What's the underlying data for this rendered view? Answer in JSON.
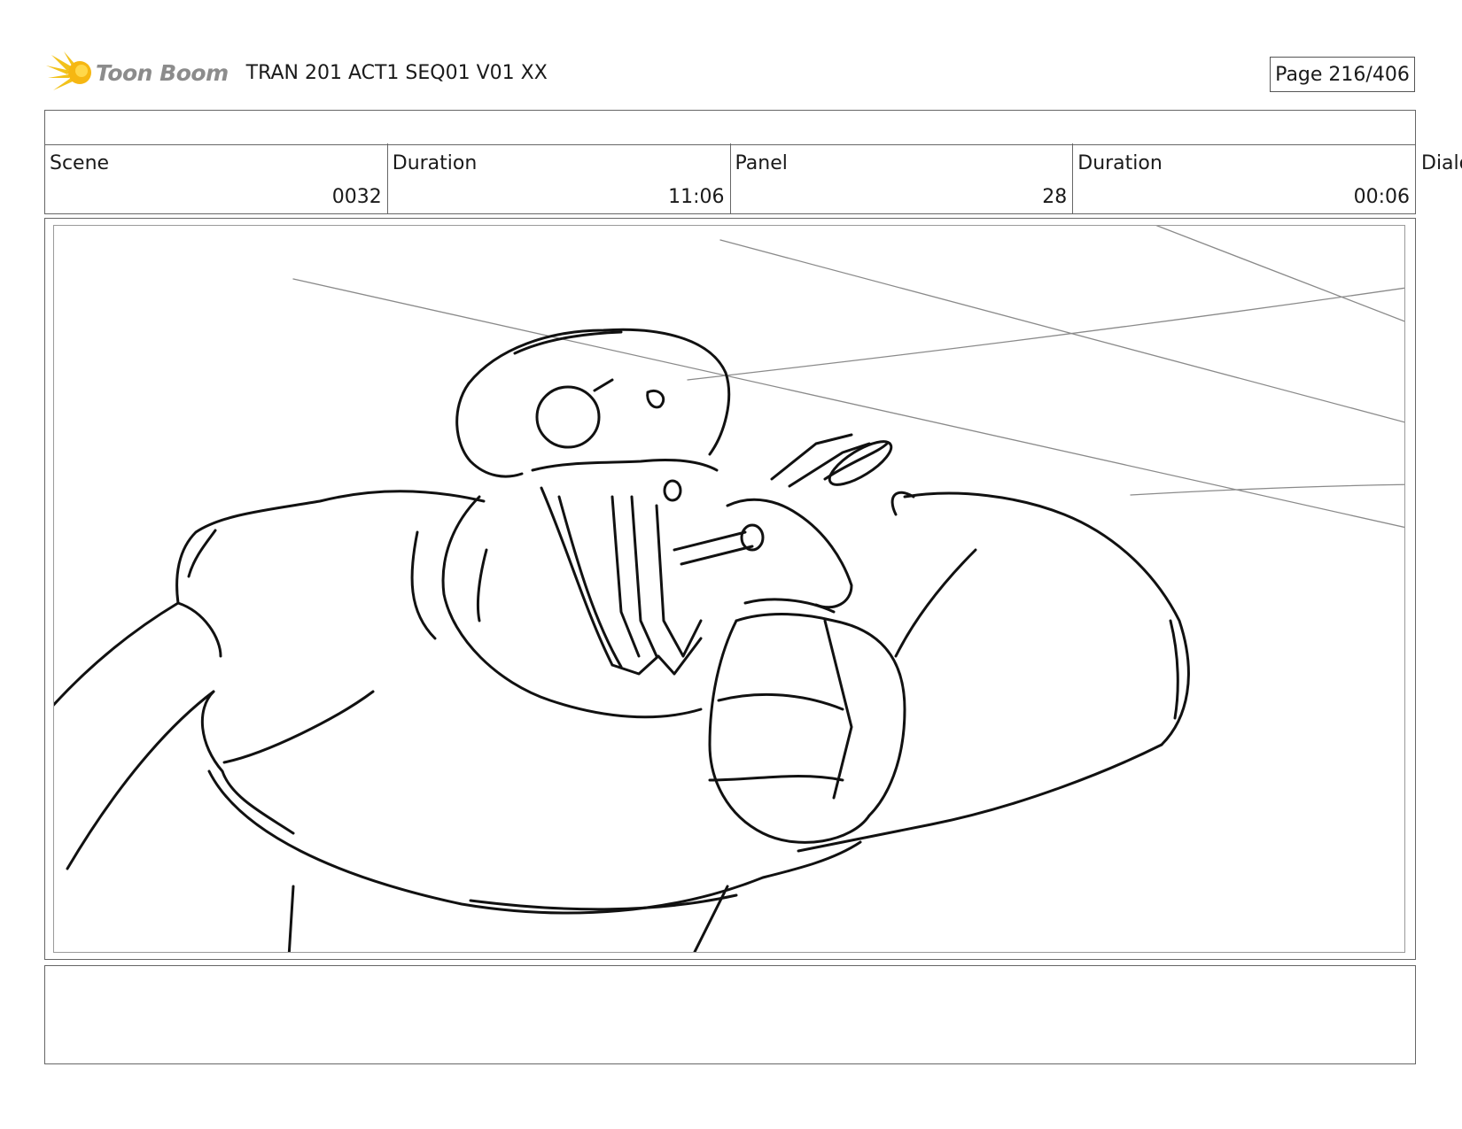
{
  "header": {
    "logo_text": "Toon Boom",
    "title": "TRAN 201 ACT1 SEQ01 V01 XX",
    "page": "Page 216/406"
  },
  "info": {
    "scene_label": "Scene",
    "scene_value": "0032",
    "scene_duration_label": "Duration",
    "scene_duration_value": "11:06",
    "panel_label": "Panel",
    "panel_value": "28",
    "panel_duration_label": "Duration",
    "panel_duration_value": "00:06",
    "dialog_label": "Dialo"
  },
  "colors": {
    "logo_accent": "#f2c21b",
    "logo_text": "#8c8c8c",
    "border": "#666666"
  }
}
